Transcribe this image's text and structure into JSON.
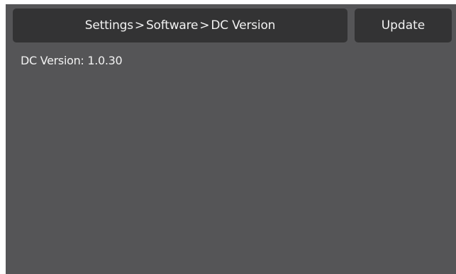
{
  "header": {
    "breadcrumb": [
      "Settings",
      "Software",
      "DC Version"
    ],
    "separator": ">",
    "update_label": "Update"
  },
  "content": {
    "version_label": "DC Version:",
    "version_value": "1.0.30"
  }
}
